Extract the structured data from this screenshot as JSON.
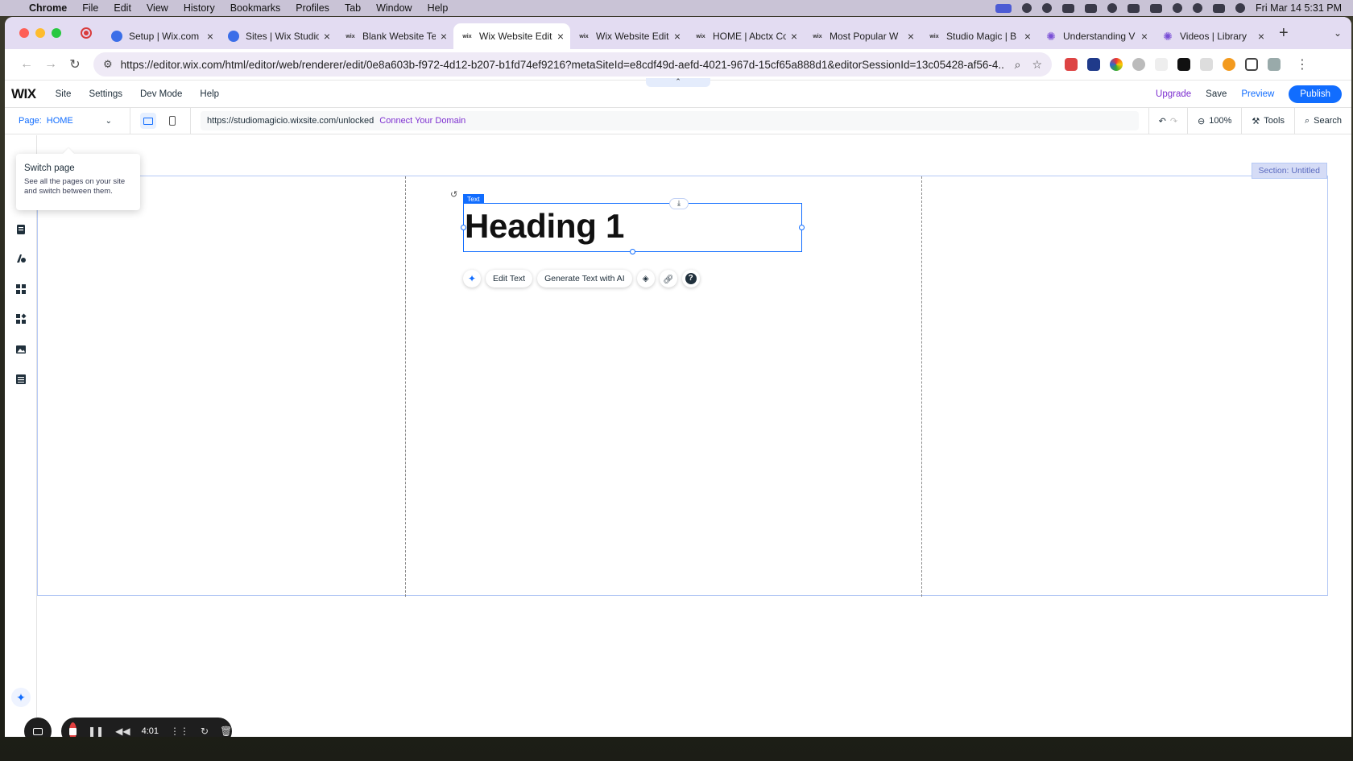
{
  "mac_menubar": {
    "app": "Chrome",
    "items": [
      "File",
      "Edit",
      "View",
      "History",
      "Bookmarks",
      "Profiles",
      "Tab",
      "Window",
      "Help"
    ],
    "clock": "Fri Mar 14  5:31 PM"
  },
  "browser": {
    "tabs": [
      {
        "title": "Setup | Wix.com",
        "icon": "wix-blue-icon"
      },
      {
        "title": "Sites | Wix Studio",
        "icon": "wix-blue-icon"
      },
      {
        "title": "Blank Website Te",
        "icon": "wix-icon"
      },
      {
        "title": "Wix Website Edit",
        "icon": "wix-icon",
        "active": true
      },
      {
        "title": "Wix Website Edit",
        "icon": "wix-icon"
      },
      {
        "title": "HOME | Abctx Co",
        "icon": "wix-icon"
      },
      {
        "title": "Most Popular W",
        "icon": "wix-icon"
      },
      {
        "title": "Studio Magic | B",
        "icon": "wix-icon"
      },
      {
        "title": "Understanding V",
        "icon": "gear-icon"
      },
      {
        "title": "Videos | Library",
        "icon": "gear-icon"
      }
    ],
    "address": "https://editor.wix.com/html/editor/web/renderer/edit/0e8a603b-f972-4d12-b207-b1fd74ef9216?metaSiteId=e8cdf49d-aefd-4021-967d-15cf65a888d1&editorSessionId=13c05428-af56-4..."
  },
  "editor": {
    "logo": "WIX",
    "menu": [
      "Site",
      "Settings",
      "Dev Mode",
      "Help"
    ],
    "upgrade": "Upgrade",
    "save": "Save",
    "preview": "Preview",
    "publish": "Publish",
    "page_label": "Page:",
    "page_name": "HOME",
    "site_url": "https://studiomagicio.wixsite.com/unlocked",
    "connect_domain": "Connect Your Domain",
    "zoom": "100%",
    "tools": "Tools",
    "search": "Search",
    "section_label": "Section: Untitled",
    "element_tag": "Text",
    "heading_text": "Heading 1",
    "actions": {
      "edit_text": "Edit Text",
      "generate_ai": "Generate Text with AI"
    }
  },
  "tooltip": {
    "title": "Switch page",
    "body": "See all the pages on your site and switch between them."
  },
  "recorder": {
    "time": "4:01"
  },
  "colors": {
    "wix_blue": "#116dff",
    "upgrade_purple": "#7d2fd0",
    "record_red": "#e24040"
  }
}
